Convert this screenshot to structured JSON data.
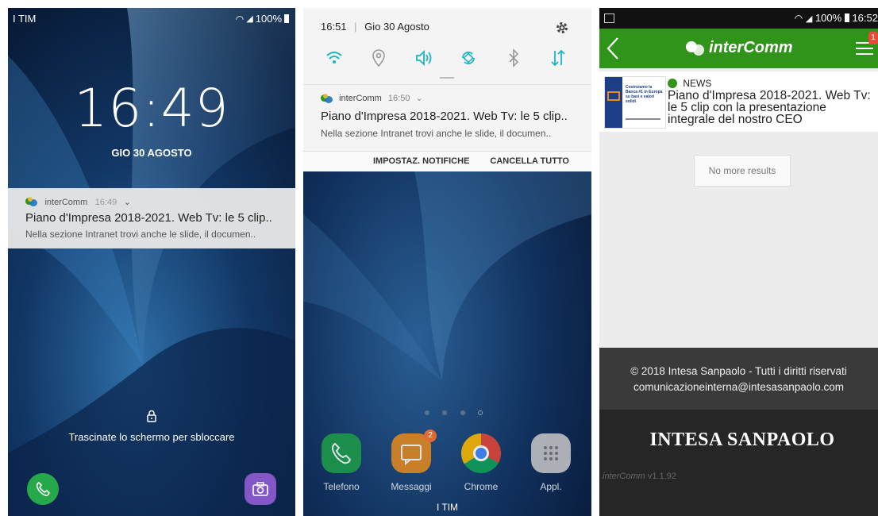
{
  "lockscreen": {
    "carrier": "I TIM",
    "battery": "100%",
    "time": "16:49",
    "date": "GIO 30 AGOSTO",
    "notification": {
      "app": "interComm",
      "time": "16:49",
      "title": "Piano d'Impresa 2018-2021. Web Tv: le 5 clip..",
      "body": "Nella sezione Intranet trovi anche le slide, il documen.."
    },
    "unlock_hint": "Trascinate lo schermo per sbloccare"
  },
  "shade": {
    "time": "16:51",
    "date": "Gio 30 Agosto",
    "notification": {
      "app": "interComm",
      "time": "16:50",
      "title": "Piano d'Impresa 2018-2021. Web Tv: le 5 clip..",
      "body": "Nella sezione Intranet trovi anche le slide, il documen.."
    },
    "actions": {
      "settings": "IMPOSTAZ. NOTIFICHE",
      "clear": "CANCELLA TUTTO"
    },
    "dock": [
      {
        "label": "Telefono"
      },
      {
        "label": "Messaggi",
        "badge": "2"
      },
      {
        "label": "Chrome"
      },
      {
        "label": "Appl."
      }
    ],
    "carrier": "I TIM"
  },
  "app": {
    "status_battery": "100%",
    "status_time": "16:52",
    "brand": "interComm",
    "menu_badge": "1",
    "news": {
      "tag": "NEWS",
      "title": "Piano d'Impresa 2018-2021. Web Tv: le 5 clip con la presentazione integrale del nostro CEO",
      "thumb_text": "Costruiamo la Banca #1 in Europa su basi e valori solidi"
    },
    "no_more": "No more results",
    "footer": {
      "copyright": "© 2018 Intesa Sanpaolo - Tutti i diritti riservati",
      "email": "comunicazioneinterna@intesasanpaolo.com",
      "bank_logo": "INTESA SANPAOLO",
      "version_app": "interComm",
      "version": "v1.1.92"
    }
  },
  "colors": {
    "green": "#2f9419",
    "accent": "#19b5c8",
    "badge": "#e84a3c"
  }
}
